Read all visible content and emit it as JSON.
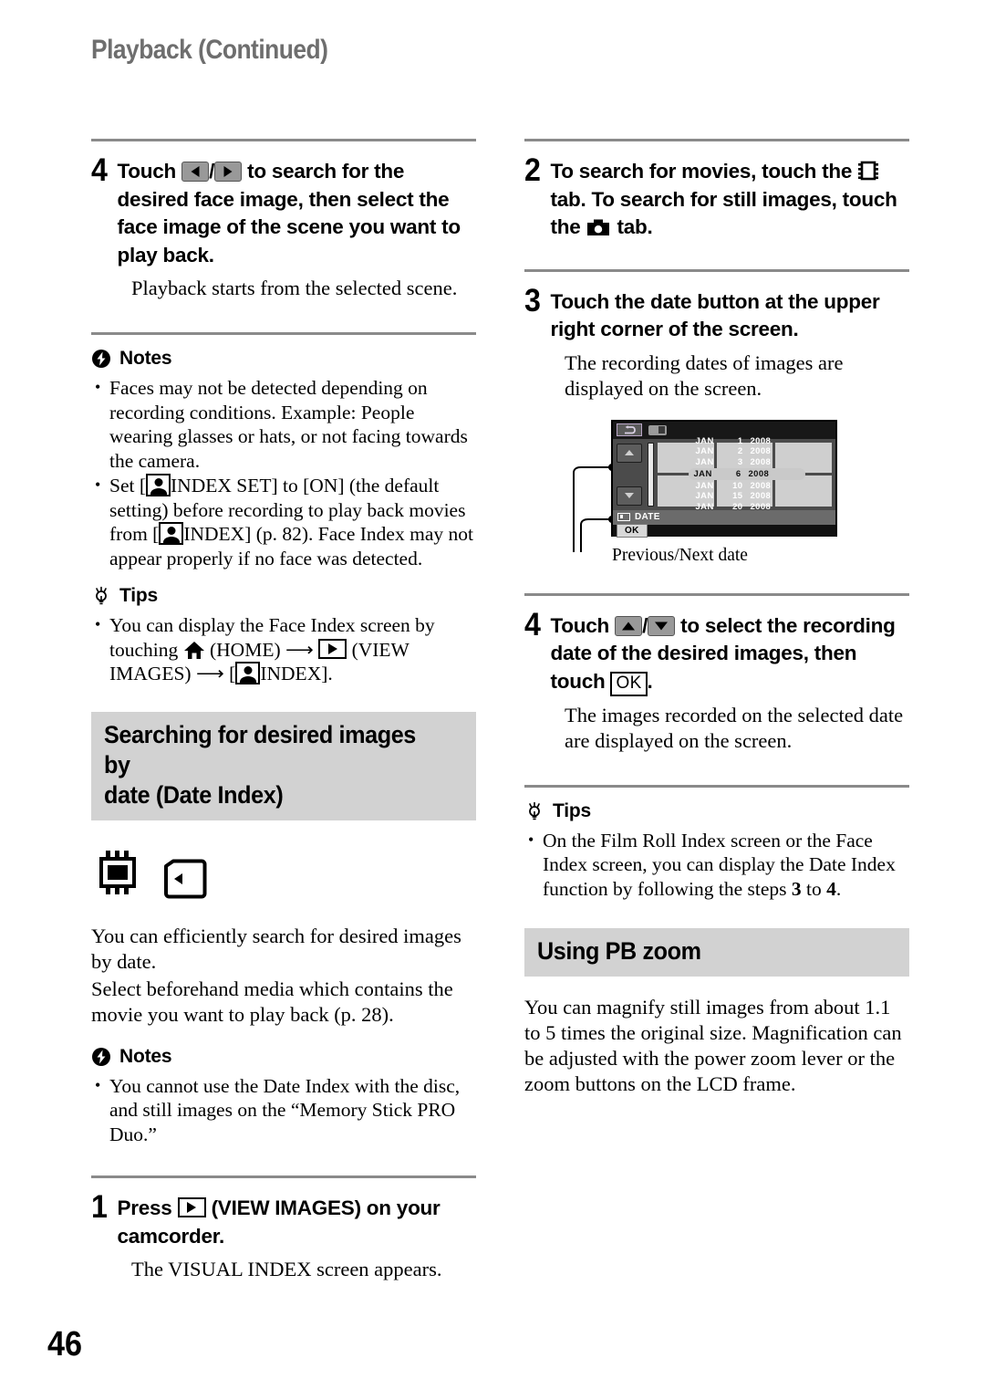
{
  "running_head": "Playback (Continued)",
  "folio": "46",
  "left_column": {
    "step4": {
      "num": "4",
      "text_a": "Touch",
      "text_b": "to search for the desired face image, then select the face image of the scene you want to play back.",
      "icon_left": "arrow-left-key-icon",
      "icon_right": "arrow-right-key-icon",
      "desc": "Playback starts from the selected scene."
    },
    "notes": {
      "label": "Notes",
      "icon": "notes-bolt-icon",
      "items": [
        "Faces may not be detected depending on recording conditions. Example: People wearing glasses or hats, or not facing towards the camera."
      ],
      "item2_parts": {
        "p1": "Set [",
        "p2": "INDEX SET] to [ON] (the default setting) before recording to play back movies from [",
        "p3": "INDEX] (p. 82). Face Index may not appear properly if no face was detected."
      }
    },
    "tips": {
      "label": "Tips",
      "icon": "tips-bulb-icon",
      "item_parts": {
        "p1": "You can display the Face Index screen by touching",
        "p2": "(HOME)",
        "p3": "(VIEW IMAGES)",
        "p4": "[",
        "p5": "INDEX]."
      }
    },
    "banner": {
      "line1": "Searching for desired images by",
      "line2": "date (Date Index)"
    },
    "media_icons": [
      "internal-memory-icon",
      "memory-stick-icon"
    ],
    "intro_p1": "You can efficiently search for desired images by date.",
    "intro_p2": "Select beforehand media which contains the movie you want to play back (p. 28).",
    "notes2": {
      "label": "Notes",
      "icon": "notes-bolt-icon",
      "items": [
        "You cannot use the Date Index with the disc, and still images on the “Memory Stick PRO Duo.”"
      ]
    },
    "step1": {
      "num": "1",
      "text_a": "Press",
      "text_b": "(VIEW IMAGES) on your camcorder.",
      "icon": "view-images-key-icon",
      "desc": "The VISUAL INDEX screen appears."
    }
  },
  "right_column": {
    "step2": {
      "num": "2",
      "text_a": "To search for movies, touch the",
      "text_b": "tab. To search for still images, touch the",
      "text_c": "tab.",
      "icon_movie": "film-strip-icon",
      "icon_still": "camera-icon"
    },
    "step3": {
      "num": "3",
      "text": "Touch the date button at the upper right corner of the screen.",
      "desc": "The recording dates of images are displayed on the screen."
    },
    "lcd": {
      "return_icon": "return-arrow-icon",
      "battery_icon": "battery-icon",
      "nav_up_icon": "nav-up-arrow-icon",
      "nav_down_icon": "nav-down-arrow-icon",
      "tab_icon": "date-tab-icon",
      "tab_label": "DATE",
      "ok_label": "OK",
      "dates": [
        {
          "month": "JAN",
          "day": "1",
          "year": "2008",
          "selected": false
        },
        {
          "month": "JAN",
          "day": "2",
          "year": "2008",
          "selected": false
        },
        {
          "month": "JAN",
          "day": "3",
          "year": "2008",
          "selected": false
        },
        {
          "month": "JAN",
          "day": "6",
          "year": "2008",
          "selected": true
        },
        {
          "month": "JAN",
          "day": "10",
          "year": "2008",
          "selected": false
        },
        {
          "month": "JAN",
          "day": "15",
          "year": "2008",
          "selected": false
        },
        {
          "month": "JAN",
          "day": "20",
          "year": "2008",
          "selected": false
        }
      ],
      "caption": "Previous/Next date"
    },
    "step4": {
      "num": "4",
      "text_a": "Touch",
      "text_b": "to select the recording date of the desired images, then touch",
      "text_c": ".",
      "icon_up": "arrow-up-key-icon",
      "icon_down": "arrow-down-key-icon",
      "ok_label": "OK",
      "desc": "The images recorded on the selected date are displayed on the screen."
    },
    "tips": {
      "label": "Tips",
      "icon": "tips-bulb-icon",
      "item_parts": {
        "p1": "On the Film Roll Index screen or the Face Index screen, you can display the Date Index function by following the steps",
        "p2": "3",
        "p3": "to",
        "p4": "4",
        "p5": "."
      }
    },
    "banner": {
      "line1": "Using PB zoom"
    },
    "pb_text": "You can magnify still images from about 1.1 to 5 times the original size. Magnification can be adjusted with the power zoom lever or the zoom buttons on the LCD frame."
  }
}
